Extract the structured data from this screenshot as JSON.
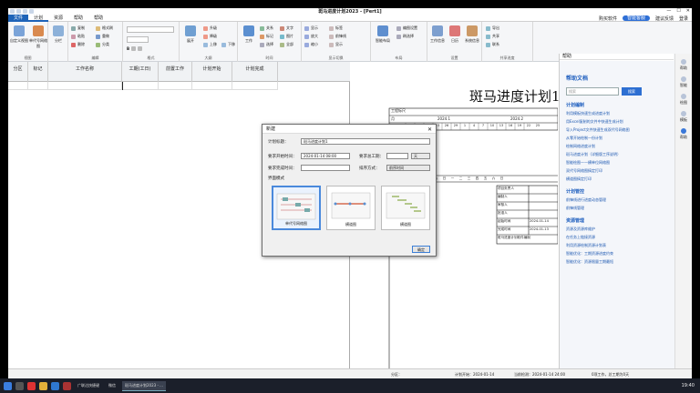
{
  "window": {
    "title": "斑马进度计划2023 - [Pert1]"
  },
  "menu": {
    "file": "文件",
    "items": [
      "计划",
      "资源",
      "帮助",
      "帮助"
    ],
    "buy": "购买软件",
    "smart": "智能客服",
    "feedback": "建议反馈",
    "account": "登录"
  },
  "ribbon": {
    "groups": [
      "视图",
      "编辑",
      "格式",
      "大纲",
      "时间",
      "显示切换",
      "布局",
      "设置",
      "共享进度"
    ],
    "view": [
      "自定义视图",
      "单代号网络图",
      "分栏"
    ],
    "edit": [
      "复制",
      "粘贴",
      "删除",
      "格式刷",
      "重做",
      "分类"
    ],
    "outline": [
      "展开",
      "升级",
      "降级",
      "上移",
      "下移"
    ],
    "tasks": [
      "工作",
      "关系",
      "标记",
      "选择"
    ],
    "text": [
      "文字",
      "图片",
      "全部"
    ],
    "display": [
      "显示",
      "放大",
      "缩小",
      "标签",
      "前锋线",
      "显示",
      "横道图",
      "关键线",
      "工作量"
    ],
    "layout": [
      "智能布局",
      "编图设置",
      "刷选择"
    ],
    "settings": [
      "工作信息",
      "日历",
      "系统信息"
    ],
    "share": [
      "导出",
      "共享",
      "联系"
    ]
  },
  "grid": {
    "headers": [
      "分区",
      "标记",
      "工作名称",
      "工期(工日)",
      "前置工作",
      "计划开始",
      "计划完成"
    ]
  },
  "chart": {
    "title": "斑马进度计划1",
    "timescale": {
      "rows": [
        "工程标尺",
        "月",
        "日"
      ],
      "months": [
        "2024.1",
        "2024.2"
      ],
      "days": [
        "14",
        "17",
        "20",
        "23",
        "26",
        "29",
        "1",
        "4",
        "7",
        "10",
        "13",
        "16",
        "19",
        "22",
        "25"
      ],
      "week": [
        "一",
        "二",
        "三",
        "四",
        "五",
        "六",
        "日",
        "一",
        "二",
        "三",
        "四",
        "五",
        "六",
        "日"
      ]
    },
    "legend": [
      {
        "label": "项目负责人",
        "value": ""
      },
      {
        "label": "编制人",
        "value": ""
      },
      {
        "label": "审核人",
        "value": ""
      },
      {
        "label": "批准人",
        "value": ""
      },
      {
        "label": "起始时间",
        "value": "2024-01-14"
      },
      {
        "label": "完成时间",
        "value": "2024-01-13"
      },
      {
        "label": "斑马进度计划软件编制",
        "value": ""
      }
    ]
  },
  "help": {
    "pane_title": "帮助",
    "title": "帮助文档",
    "search_placeholder": "搜索",
    "search_button": "搜索",
    "sections": [
      {
        "title": "计划编制",
        "links": [
          "利用模板快速生成进度计划",
          "用Excel复制的文件中快速生成计划",
          "导入Project文件快速生成双代号网络图",
          "从零开始绘制一份计划",
          "绘制网络进度计划",
          "斑马进度计划（详细版工序说明）",
          "智能绘图——横单位网络图",
          "双代号网络图搞定打印",
          "横道图搞定打印"
        ]
      },
      {
        "title": "计划管控",
        "links": [
          "前锋线进行进度动态管理",
          "前锋线管理"
        ]
      },
      {
        "title": "资源管理",
        "links": [
          "资源及资源库维护",
          "在任务上链接资源",
          "利用资源绘制资源计划表",
          "智能优化：工期资源进度约束",
          "智能优化：资源限量工期最短"
        ]
      }
    ],
    "side": [
      "帮助",
      "智能",
      "绘图",
      "模板",
      "帮助"
    ]
  },
  "status": {
    "zone": "分区：",
    "start": "计划开始：2024-01-14",
    "current": "当前检测：2024-01-14 24:00",
    "done": "0项工作，总工期为0天"
  },
  "dialog": {
    "title": "新建",
    "close": "✕",
    "plan_name_label": "计划标题：",
    "plan_name": "斑马进度计划1",
    "start_label": "要求开始时间：",
    "start": "2024-01-14 08:00",
    "duration_label": "要求总工期：",
    "duration": "",
    "duration_unit": "天",
    "finish_label": "要求完成时间：",
    "finish": "",
    "order_label": "排序方式：",
    "order": "前序时间",
    "mode_label": "界面模式",
    "modes": [
      "单代号网络图",
      "横道图",
      "横道图"
    ],
    "ok": "确定"
  },
  "taskbar": {
    "tasks": [
      "广联达快捷键",
      "微信",
      "斑马进度计划2023 - ..."
    ],
    "time": "19:40"
  }
}
